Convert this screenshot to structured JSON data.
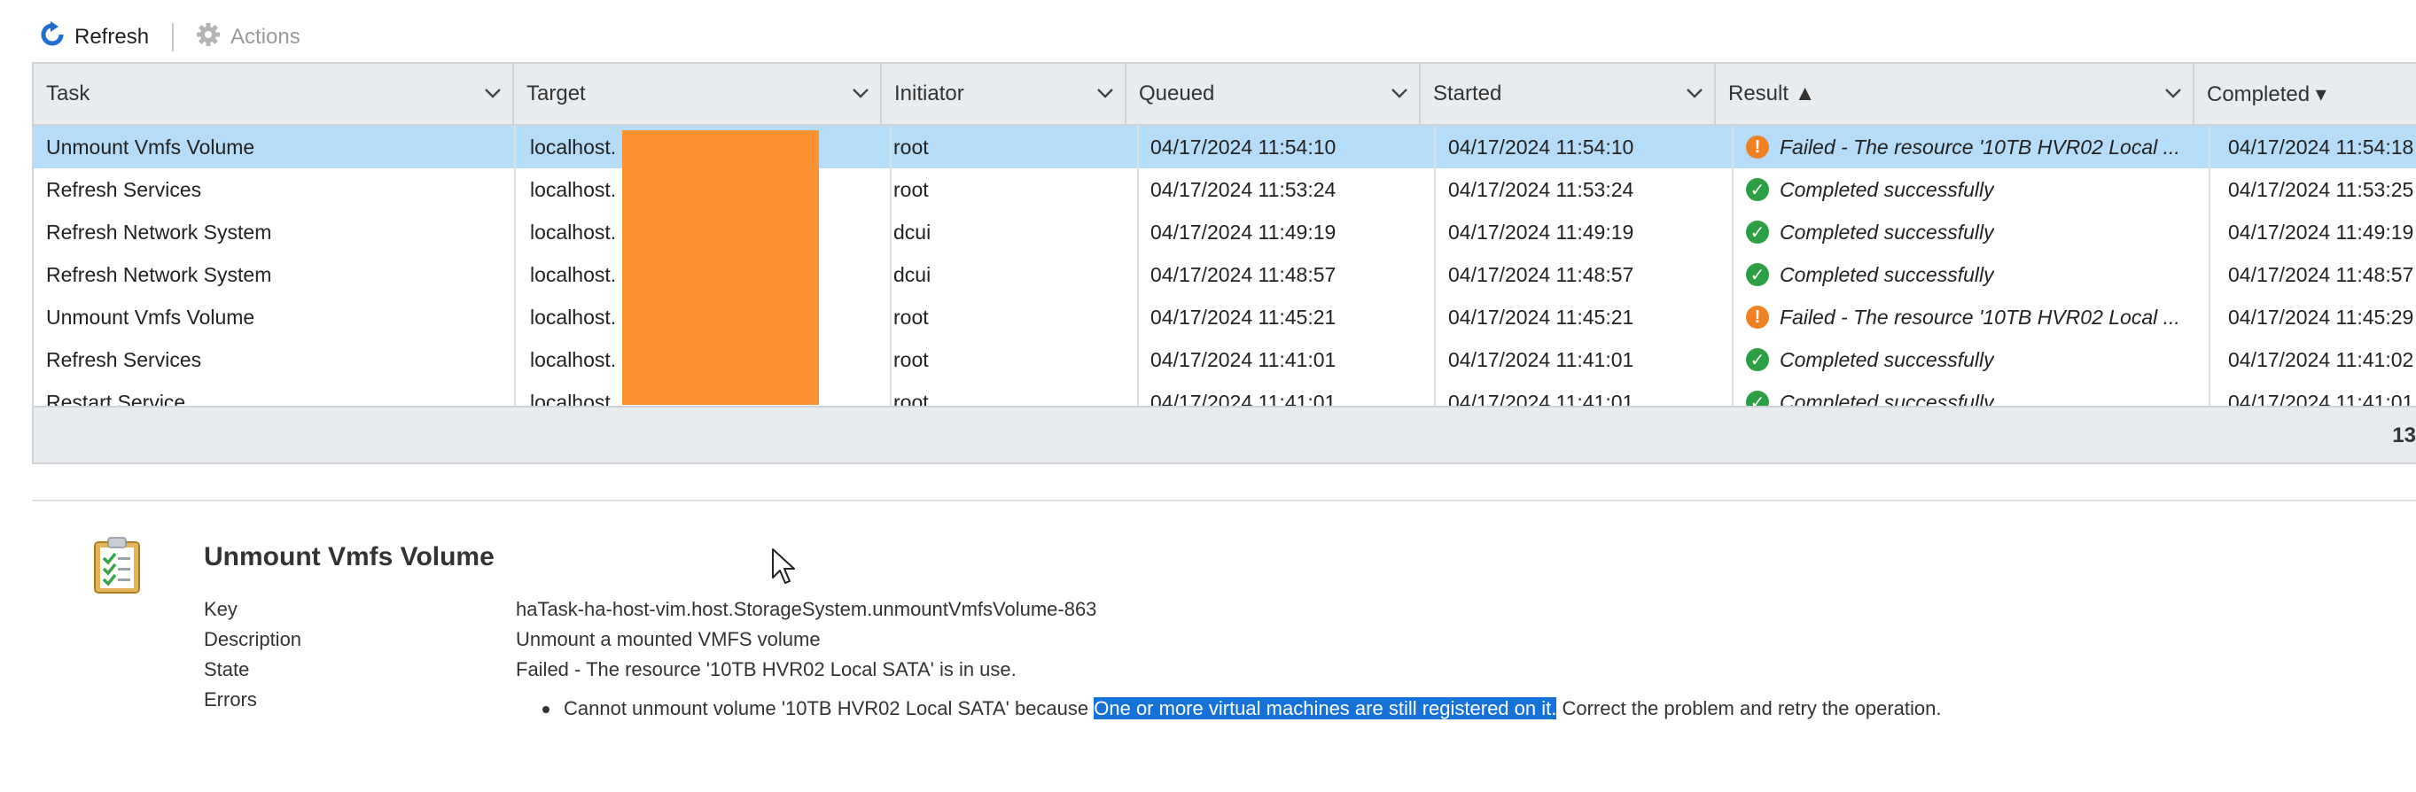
{
  "toolbar": {
    "refresh_label": "Refresh",
    "actions_label": "Actions"
  },
  "grid": {
    "columns": [
      "Task",
      "Target",
      "Initiator",
      "Queued",
      "Started",
      "Result ▲",
      "Completed ▾"
    ],
    "rows": [
      {
        "task": "Unmount Vmfs Volume",
        "target": "localhost.",
        "initiator": "root",
        "queued": "04/17/2024 11:54:10",
        "started": "04/17/2024 11:54:10",
        "result": "Failed - The resource '10TB HVR02 Local ...",
        "status": "failed",
        "completed": "04/17/2024 11:54:18",
        "selected": true
      },
      {
        "task": "Refresh Services",
        "target": "localhost.",
        "initiator": "root",
        "queued": "04/17/2024 11:53:24",
        "started": "04/17/2024 11:53:24",
        "result": "Completed successfully",
        "status": "ok",
        "completed": "04/17/2024 11:53:25",
        "selected": false
      },
      {
        "task": "Refresh Network System",
        "target": "localhost.",
        "initiator": "dcui",
        "queued": "04/17/2024 11:49:19",
        "started": "04/17/2024 11:49:19",
        "result": "Completed successfully",
        "status": "ok",
        "completed": "04/17/2024 11:49:19",
        "selected": false
      },
      {
        "task": "Refresh Network System",
        "target": "localhost.",
        "initiator": "dcui",
        "queued": "04/17/2024 11:48:57",
        "started": "04/17/2024 11:48:57",
        "result": "Completed successfully",
        "status": "ok",
        "completed": "04/17/2024 11:48:57",
        "selected": false
      },
      {
        "task": "Unmount Vmfs Volume",
        "target": "localhost.",
        "initiator": "root",
        "queued": "04/17/2024 11:45:21",
        "started": "04/17/2024 11:45:21",
        "result": "Failed - The resource '10TB HVR02 Local ...",
        "status": "failed",
        "completed": "04/17/2024 11:45:29",
        "selected": false
      },
      {
        "task": "Refresh Services",
        "target": "localhost.",
        "initiator": "root",
        "queued": "04/17/2024 11:41:01",
        "started": "04/17/2024 11:41:01",
        "result": "Completed successfully",
        "status": "ok",
        "completed": "04/17/2024 11:41:02",
        "selected": false
      },
      {
        "task": "Restart Service",
        "target": "localhost.",
        "initiator": "root",
        "queued": "04/17/2024 11:41:01",
        "started": "04/17/2024 11:41:01",
        "result": "Completed successfully",
        "status": "ok",
        "completed": "04/17/2024 11:41:01",
        "selected": false
      }
    ],
    "footer_count": "13"
  },
  "detail": {
    "title": "Unmount Vmfs Volume",
    "labels": {
      "key": "Key",
      "description": "Description",
      "state": "State",
      "errors": "Errors"
    },
    "key": "haTask-ha-host-vim.host.StorageSystem.unmountVmfsVolume-863",
    "description": "Unmount a mounted VMFS volume",
    "state": "Failed - The resource '10TB HVR02 Local SATA' is in use.",
    "error_before": "Cannot unmount volume '10TB HVR02 Local SATA' because ",
    "error_highlight": "One or more virtual machines are still registered on it.",
    "error_after": " Correct the problem and retry the operation."
  },
  "colors": {
    "selected_row": "#b5dcf8",
    "redaction": "#fc9332",
    "failed_icon": "#f08123",
    "ok_icon": "#2e9e44",
    "text_highlight": "#1672d6"
  },
  "icons": {
    "refresh": "refresh-icon",
    "actions": "gear-icon",
    "failed": "warning-icon",
    "ok": "checkmark-icon",
    "task": "clipboard-checklist-icon",
    "sort": "chevron-down-icon"
  }
}
